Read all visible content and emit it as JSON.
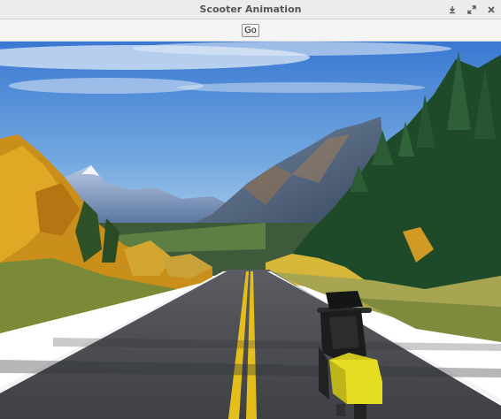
{
  "window": {
    "title": "Scooter Animation",
    "controls": [
      "minimize-icon",
      "maximize-icon",
      "close-icon"
    ]
  },
  "toolbar": {
    "go_label": "Go"
  },
  "scene": {
    "description_icon": "landscape-road-image",
    "colors": {
      "sky_top": "#3f7fd6",
      "sky_bottom": "#b9d6ee",
      "road": "#4a4c52",
      "center_line": "#e8c21a",
      "edge_line": "#ffffff",
      "scooter_yellow": "#e3dc24",
      "scooter_dark": "#1f2020"
    }
  }
}
